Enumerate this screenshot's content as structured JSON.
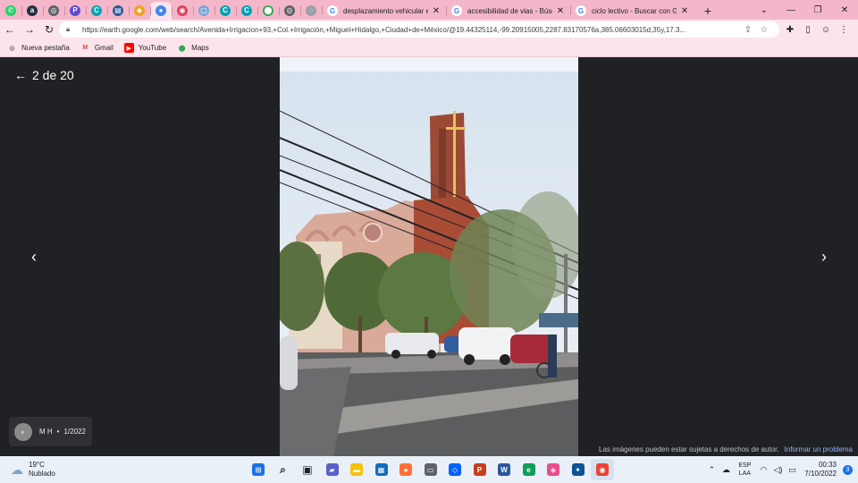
{
  "browser": {
    "pinned_tabs": [
      {
        "icon": "whatsapp-icon",
        "glyph": "✆",
        "color": "#25d366"
      },
      {
        "icon": "amazon-icon",
        "glyph": "a",
        "color": "#232f3e"
      },
      {
        "icon": "globe-icon",
        "glyph": "◎",
        "color": "#5f6368"
      },
      {
        "icon": "p-app-icon",
        "glyph": "P",
        "color": "#5b4bd6"
      },
      {
        "icon": "canva-icon",
        "glyph": "C",
        "color": "#00a3b4"
      },
      {
        "icon": "docs-icon",
        "glyph": "▤",
        "color": "#2b579a"
      },
      {
        "icon": "tile-icon",
        "glyph": "◆",
        "color": "#f4a020"
      },
      {
        "icon": "earth-icon",
        "glyph": "●",
        "color": "#4285f4"
      },
      {
        "icon": "instagram-icon",
        "glyph": "◉",
        "color": "#e4405f"
      },
      {
        "icon": "screen-icon",
        "glyph": "▢",
        "color": "#7aa7d6"
      },
      {
        "icon": "canva-icon",
        "glyph": "C",
        "color": "#00a3b4"
      },
      {
        "icon": "canva-icon",
        "glyph": "C",
        "color": "#00a3b4"
      },
      {
        "icon": "maps-icon",
        "glyph": "⬤",
        "color": "#34a853"
      },
      {
        "icon": "globe-icon",
        "glyph": "◎",
        "color": "#5f6368"
      },
      {
        "icon": "loading-icon",
        "glyph": "◌",
        "color": "#9aa0a6"
      }
    ],
    "tabs": [
      {
        "title": "desplazamiento vehicular em"
      },
      {
        "title": "accesibilidad de vias - Búsqueda"
      },
      {
        "title": "ciclo lectivo - Buscar con Goo"
      }
    ],
    "url": "https://earth.google.com/web/search/Avenida+Irrigacion+93,+Col.+Irrigación,+Miguel+Hidalgo,+Ciudad+de+México/@19.44325114,-99.20915005,2287.83170576a,385.06603015d,35y,17.3...",
    "bookmarks": [
      {
        "label": "Nueva pestaña",
        "icon": "globe-icon"
      },
      {
        "label": "Gmail",
        "icon": "gmail-icon"
      },
      {
        "label": "YouTube",
        "icon": "youtube-icon"
      },
      {
        "label": "Maps",
        "icon": "maps-pin-icon"
      }
    ],
    "theme_colors": {
      "tabstrip": "#f4b7ca",
      "toolbar": "#fce4ec"
    }
  },
  "viewer": {
    "counter": "2 de 20",
    "attribution": {
      "name": "M H",
      "separator": "•",
      "date": "1/2022"
    },
    "copyright": "Las imágenes pueden estar sujetas a derechos de autor.",
    "report_link": "Informar un problema"
  },
  "taskbar": {
    "weather": {
      "temp": "19°C",
      "condition": "Nublado"
    },
    "apps": [
      {
        "icon": "windows-start-icon",
        "color": "#1a73e8",
        "glyph": "⊞"
      },
      {
        "icon": "search-icon",
        "color": "#202124",
        "glyph": "⌕"
      },
      {
        "icon": "task-view-icon",
        "color": "#202124",
        "glyph": "▣"
      },
      {
        "icon": "teams-chat-icon",
        "color": "#5b5fc7",
        "glyph": "▰"
      },
      {
        "icon": "file-explorer-icon",
        "color": "#f4c20d",
        "glyph": "▬"
      },
      {
        "icon": "store-icon",
        "color": "#0f6cbd",
        "glyph": "▦"
      },
      {
        "icon": "firefox-icon",
        "color": "#ff7139",
        "glyph": "●"
      },
      {
        "icon": "keyboard-icon",
        "color": "#5f6368",
        "glyph": "▭"
      },
      {
        "icon": "dropbox-icon",
        "color": "#0061ff",
        "glyph": "◇"
      },
      {
        "icon": "powerpoint-icon",
        "color": "#c43e1c",
        "glyph": "P"
      },
      {
        "icon": "word-icon",
        "color": "#2b579a",
        "glyph": "W"
      },
      {
        "icon": "edge-icon",
        "color": "#0f9d58",
        "glyph": "e"
      },
      {
        "icon": "paint-icon",
        "color": "#e84f8a",
        "glyph": "◈"
      },
      {
        "icon": "app-icon",
        "color": "#0b5394",
        "glyph": "✦"
      },
      {
        "icon": "chrome-icon",
        "color": "#ea4335",
        "glyph": "◉"
      }
    ],
    "language": {
      "line1": "ESP",
      "line2": "LAA"
    },
    "clock": {
      "time": "00:33",
      "date": "7/10/2022"
    },
    "notifications": "3"
  }
}
